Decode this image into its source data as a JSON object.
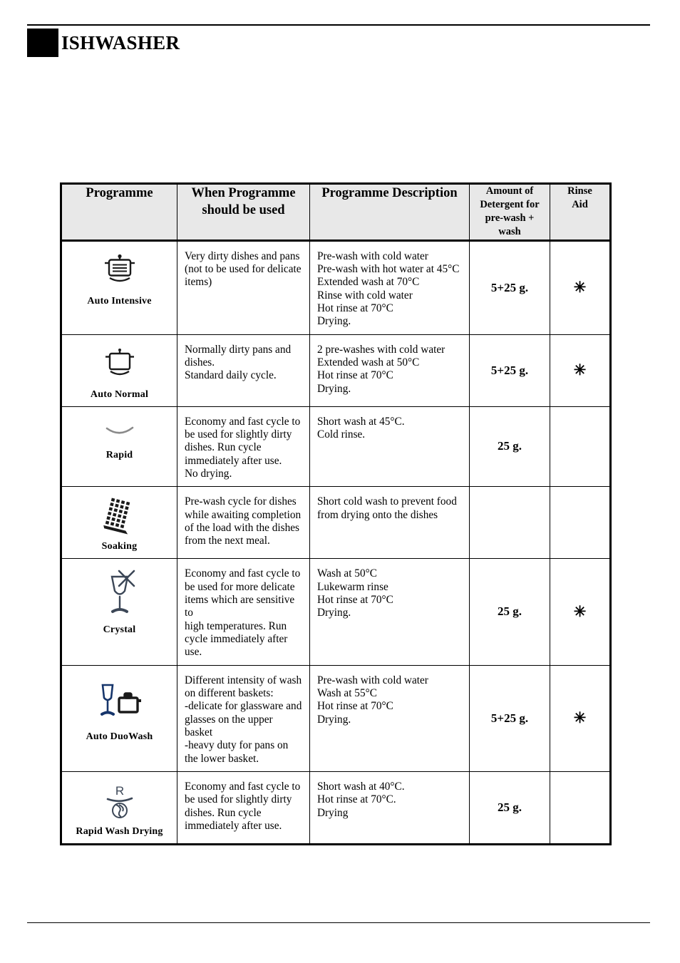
{
  "page": {
    "header_title": "ISHWASHER"
  },
  "table": {
    "headers": {
      "programme": "Programme",
      "when_used_line1": "When Programme",
      "when_used_line2": "should be used",
      "description": "Programme Description",
      "amount_line1": "Amount of",
      "amount_line2": "Detergent for",
      "amount_line3": "pre-wash +",
      "amount_line4": "wash",
      "rinse_line1": "Rinse",
      "rinse_line2": "Aid"
    },
    "rows": [
      {
        "name": "Auto Intensive",
        "icon": "pot-with-lid-lines-icon",
        "when": [
          "Very dirty dishes and pans",
          "(not to be used for delicate",
          "items)"
        ],
        "description": [
          "Pre-wash with cold water",
          "Pre-wash with hot water at 45°C",
          "Extended wash at 70°C",
          "Rinse with cold water",
          "Hot rinse at 70°C",
          "Drying."
        ],
        "amount": "5+25 g.",
        "rinse_aid": "✳"
      },
      {
        "name": "Auto Normal",
        "icon": "pot-with-lid-icon",
        "when": [
          "Normally dirty pans and",
          "dishes.",
          "Standard daily cycle."
        ],
        "description": [
          "2 pre-washes with cold water",
          "Extended wash at 50°C",
          "Hot rinse at 70°C",
          "Drying."
        ],
        "amount": "5+25 g.",
        "rinse_aid": "✳"
      },
      {
        "name": "Rapid",
        "icon": "shallow-dish-arc-icon",
        "when": [
          "Economy and fast cycle to",
          "be used for slightly dirty",
          "dishes. Run cycle",
          "immediately after use.",
          "No drying."
        ],
        "description": [
          "Short wash at 45°C.",
          "Cold rinse."
        ],
        "amount": "25 g.",
        "rinse_aid": ""
      },
      {
        "name": "Soaking",
        "icon": "tilted-dish-rack-icon",
        "when": [
          "Pre-wash cycle for dishes",
          "while awaiting completion",
          "of the load with the dishes",
          "from the next meal."
        ],
        "description": [
          "Short cold wash to prevent food",
          "from drying onto the dishes"
        ],
        "amount": "",
        "rinse_aid": ""
      },
      {
        "name": "Crystal",
        "icon": "wine-glass-sparkle-icon",
        "when": [
          "Economy and fast cycle to",
          "be used for more delicate",
          "items which are sensitive to",
          "high temperatures. Run",
          "cycle immediately after use."
        ],
        "description": [
          "Wash at 50°C",
          "Lukewarm rinse",
          "Hot rinse at 70°C",
          "Drying."
        ],
        "amount": "25 g.",
        "rinse_aid": "✳"
      },
      {
        "name": "Auto DuoWash",
        "icon": "glass-and-pot-icon",
        "when": [
          "Different intensity of wash",
          "on different baskets:",
          "-delicate for glassware and",
          "glasses on the upper",
          "basket",
          "-heavy duty for pans on",
          "the lower basket."
        ],
        "description": [
          "Pre-wash with cold water",
          "Wash at 55°C",
          "Hot rinse at 70°C",
          "Drying."
        ],
        "amount": "5+25 g.",
        "rinse_aid": "✳"
      },
      {
        "name": "Rapid Wash Drying",
        "icon": "r-arc-drying-fan-icon",
        "when": [
          "Economy and fast cycle to",
          "be used for slightly dirty",
          "dishes. Run cycle",
          "immediately after use."
        ],
        "description": [
          "Short wash at 40°C.",
          "Hot rinse at 70°C.",
          "Drying"
        ],
        "amount": "25 g.",
        "rinse_aid": ""
      }
    ]
  },
  "colors": {
    "header_fill": "#e8e8e8",
    "border": "#000000",
    "icon_dark": "#1a1a1a",
    "icon_navy": "#16356b",
    "icon_slate": "#3c4757",
    "icon_gray": "#8a8a8a"
  }
}
